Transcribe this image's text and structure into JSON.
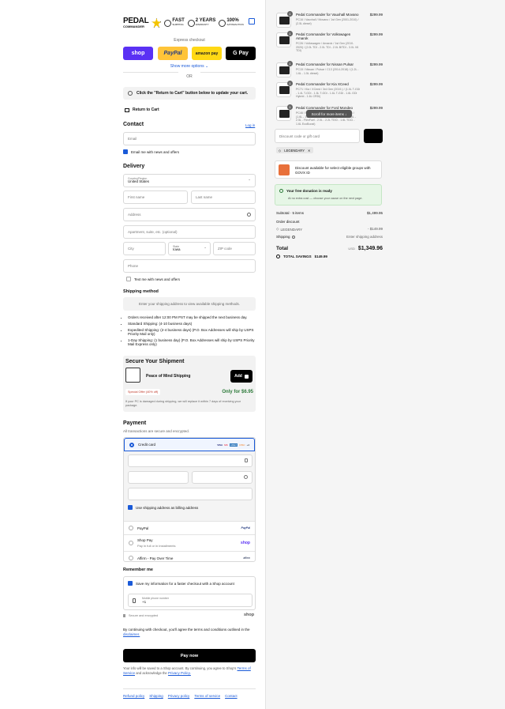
{
  "brand": {
    "logo_top": "PEDAL",
    "logo_bottom": "COMMANDER",
    "badge1": "FAST",
    "badge1_sub": "SHIPPING",
    "badge2": "2 YEARS",
    "badge2_sub": "WARRANTY",
    "badge3": "100%",
    "badge3_sub": "SATISFACTION"
  },
  "express": {
    "label": "Express checkout",
    "shop": "shop",
    "paypal": "PayPal",
    "amazon": "amazon pay",
    "gpay": "G Pay",
    "more": "Show more options",
    "or": "OR"
  },
  "note": "Click the \"Return to Cart\" button below to update your cart.",
  "return_cart": "Return to Cart",
  "contact": {
    "title": "Contact",
    "login": "Log in",
    "email_placeholder": "Email",
    "email_news": "Email me with news and offers"
  },
  "delivery": {
    "title": "Delivery",
    "country_label": "Country/Region",
    "country": "United States",
    "first": "First name",
    "last": "Last name",
    "address": "Address",
    "apt": "Apartment, suite, etc. (optional)",
    "city": "City",
    "state_label": "State",
    "state": "Iowa",
    "zip": "ZIP code",
    "phone": "Phone",
    "text_news": "Text me with news and offers"
  },
  "shipping": {
    "title": "Shipping method",
    "placeholder": "Enter your shipping address to view available shipping methods.",
    "bullets": [
      "Orders received after 12:00 PM PST may be shipped the next business day.",
      "Standard Shipping: (4-10 business days)",
      "Expedited Shipping: (2-4 business days) (P.O. Box Addresses will ship by USPS Priority Mail only)",
      "1-Day Shipping: (1 business day) (P.O. Box Addresses will ship by USPS Priority Mail Express only)"
    ]
  },
  "secure": {
    "title": "Secure Your Shipment",
    "product": "Peace of Mind Shipping",
    "add": "Add",
    "offer": "Special Offer (40% off)",
    "price": "Only for $6.95",
    "desc": "If your PC is damaged during shipping, we will replace it within 7 days of receiving your package."
  },
  "payment": {
    "title": "Payment",
    "subtitle": "All transactions are secure and encrypted.",
    "credit": "Credit card",
    "cards": [
      "VISA",
      "MC",
      "AMEX",
      "DISC",
      "+4"
    ],
    "billing": "Use shipping address as billing address",
    "paypal": "PayPal",
    "paypal_logo": "PayPal",
    "shoppay": "Shop Pay",
    "shoppay_sub": "Pay in full or in installments",
    "shoppay_logo": "shop",
    "affirm": "Affirm - Pay Over Time",
    "affirm_logo": "affirm"
  },
  "remember": {
    "title": "Remember me",
    "save": "Save my information for a faster checkout with a Shop account",
    "phone_label": "Mobile phone number",
    "phone_prefix": "+1",
    "secure": "Secure and encrypted",
    "shop": "shop"
  },
  "terms": {
    "text": "By continuing with checkout, you'll agree the terms and conditions outlined in the",
    "link": "disclaimer."
  },
  "paynow": "Pay now",
  "saved": {
    "text": "Your info will be saved to a Shop account. By continuing, you agree to Shop's",
    "terms": "Terms of Service",
    "mid": "and acknowledge the",
    "privacy": "Privacy Policy."
  },
  "footer": [
    "Refund policy",
    "Shipping",
    "Privacy policy",
    "Terms of service",
    "Contact"
  ],
  "items": [
    {
      "qty": "1",
      "name": "Pedal Commander for Vauxhall Movano",
      "desc": "PC16 / Vauxhall / Movano / 1st Gen (2001-2010) / (2.5L diesel)",
      "price": "$299.99"
    },
    {
      "qty": "1",
      "name": "Pedal Commander for Volkswagen Amarok",
      "desc": "PC26 / Volkswagen / Amarok / 1st Gen (2010-2020) / (2.0L TDI - 2.0L TDI - 2.0L BiTDI - 3.0L V6 TDI)",
      "price": "$299.99"
    },
    {
      "qty": "1",
      "name": "Pedal Commander for Nissan Pulsar",
      "desc": "PC15 / Nissan / Pulsar / C13 (2014-2018) / (1.2L - 1.6L - 1.5L diesel)",
      "price": "$299.99"
    },
    {
      "qty": "1",
      "name": "Pedal Commander for Kia XCeed",
      "desc": "PC71 / Kia / XCeed / 3rd Gen (2019-) / (1.0L T-GDi - 1.4L T-GDi - 1.5L T-GDi - 1.6L T-GDi - 1.6L GDi Hybrid - 1.6L CRDi)",
      "price": "$299.99"
    },
    {
      "qty": "1",
      "name": "Pedal Commander for Ford Mondeo",
      "desc": "PC46 / Ford / Mondeo / 4th Gen (2007-2014) / (1.6L - 1.8L TDCi - 2.0L - 2.0L EcoBoost - 2.3L - 2.5L - FlexFuel - 2.0L - 2.2L TDCi - 1.6L TDCi - 1.6L EcoBoost)",
      "price": "$299.99"
    }
  ],
  "tooltip": "Scroll for more items",
  "discount": {
    "placeholder": "Discount code or gift card",
    "tag": "LEGENDARY"
  },
  "govx": "Discount available for select eligible groups with GOVX ID",
  "donation": {
    "title": "Your free donation is ready",
    "sub": "At no extra cost — choose your cause on the next page."
  },
  "summary": {
    "subtotal_label": "Subtotal · 5 items",
    "subtotal": "$1,499.95",
    "order_discount": "Order discount",
    "code": "LEGENDARY",
    "code_amount": "- $149.99",
    "shipping_label": "Shipping",
    "shipping_value": "Enter shipping address",
    "total_label": "Total",
    "currency": "USD",
    "total": "$1,349.96",
    "savings_label": "TOTAL SAVINGS",
    "savings": "$149.99"
  }
}
